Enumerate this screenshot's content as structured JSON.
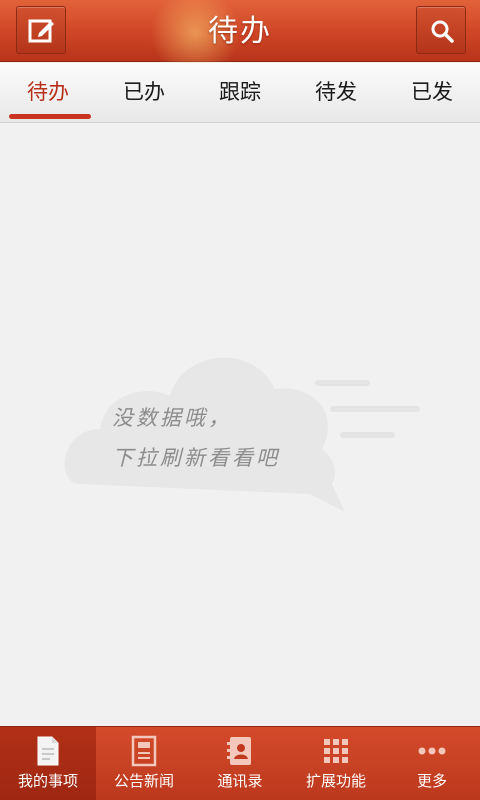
{
  "header": {
    "title": "待办",
    "left_icon": "edit-icon",
    "right_icon": "search-icon"
  },
  "tabs": [
    {
      "label": "待办",
      "active": true
    },
    {
      "label": "已办",
      "active": false
    },
    {
      "label": "跟踪",
      "active": false
    },
    {
      "label": "待发",
      "active": false
    },
    {
      "label": "已发",
      "active": false
    }
  ],
  "empty_state": {
    "line1": "没数据哦，",
    "line2": "下拉刷新看看吧"
  },
  "bottom_nav": [
    {
      "label": "我的事项",
      "icon": "document-icon",
      "active": true
    },
    {
      "label": "公告新闻",
      "icon": "news-icon",
      "active": false
    },
    {
      "label": "通讯录",
      "icon": "contacts-icon",
      "active": false
    },
    {
      "label": "扩展功能",
      "icon": "grid-icon",
      "active": false
    },
    {
      "label": "更多",
      "icon": "more-icon",
      "active": false
    }
  ],
  "colors": {
    "brand": "#cf4526",
    "active_tab": "#b82f1c",
    "background": "#f1f1f1"
  }
}
